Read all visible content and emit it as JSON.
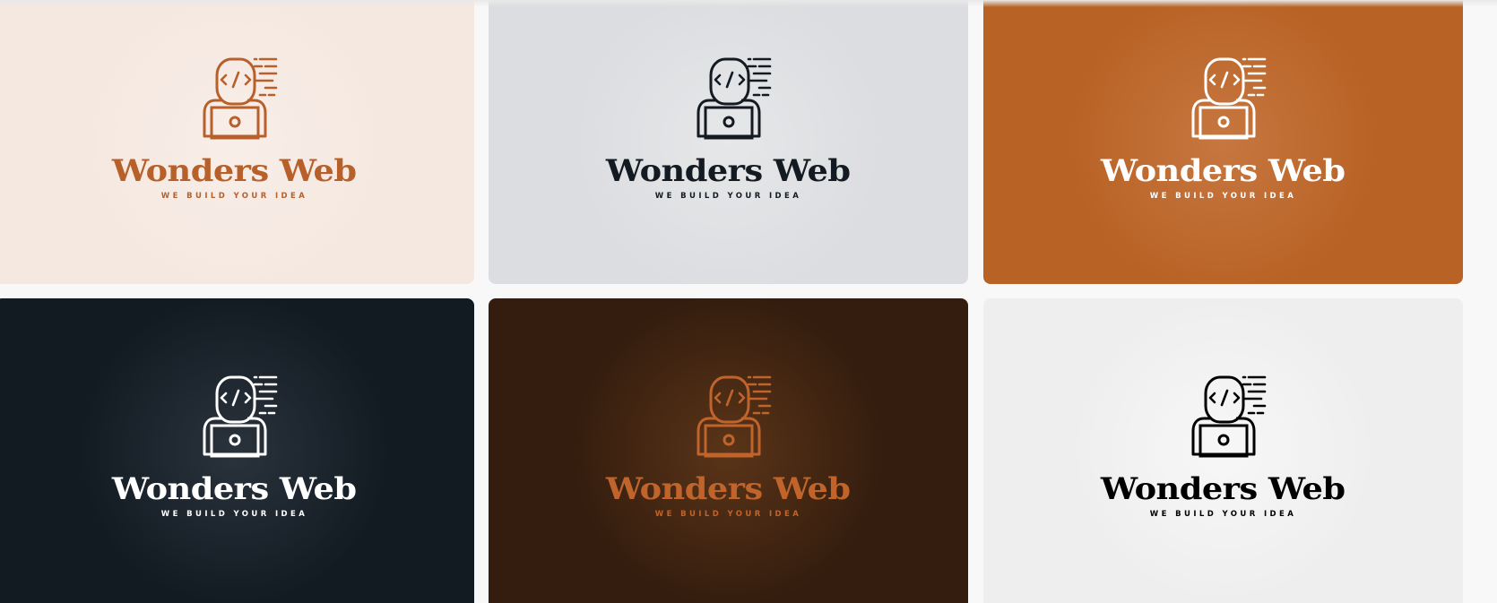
{
  "gallery": {
    "cards": [
      {
        "brand": "Wonders Web",
        "tagline": "WE BUILD YOUR IDEA",
        "bg": "#f5e8e0",
        "bg_glow": "#f8eee8",
        "ink": "#b8602a"
      },
      {
        "brand": "Wonders Web",
        "tagline": "WE BUILD YOUR IDEA",
        "bg": "#dcdde0",
        "bg_glow": "#e6e7e9",
        "ink": "#141a22"
      },
      {
        "brand": "Wonders Web",
        "tagline": "WE BUILD YOUR IDEA",
        "bg": "#b96226",
        "bg_glow": "#c6773f",
        "ink": "#ffffff"
      },
      {
        "brand": "Wonders Web",
        "tagline": "WE BUILD YOUR IDEA",
        "bg": "#121a22",
        "bg_glow": "#2a323c",
        "ink": "#ffffff"
      },
      {
        "brand": "Wonders Web",
        "tagline": "WE BUILD YOUR IDEA",
        "bg": "#341d0e",
        "bg_glow": "#5a3418",
        "ink": "#c0642b"
      },
      {
        "brand": "Wonders Web",
        "tagline": "WE BUILD YOUR IDEA",
        "bg": "#eeeeee",
        "bg_glow": "#f7f7f7",
        "ink": "#000000"
      }
    ]
  }
}
